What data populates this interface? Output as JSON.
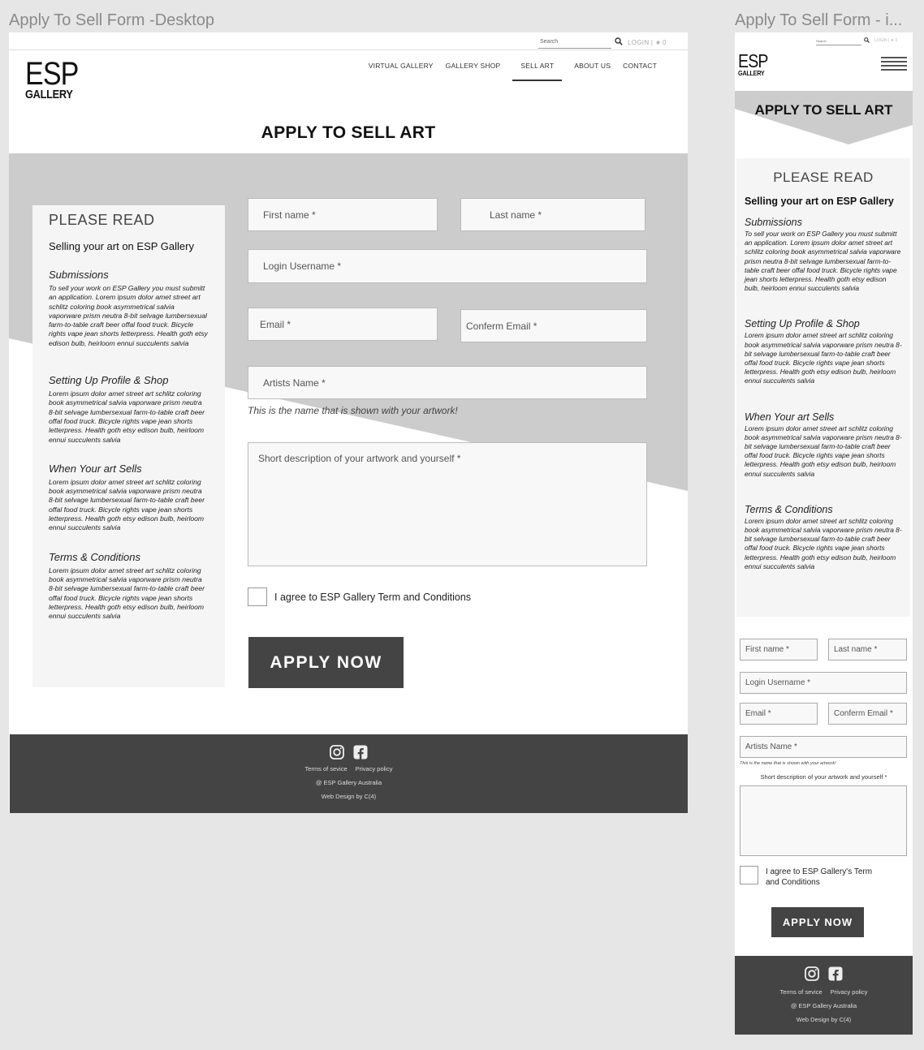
{
  "artboards": {
    "desktop_title": "Apply To Sell Form -Desktop",
    "mobile_title": "Apply To Sell Form - i..."
  },
  "header": {
    "search_placeholder": "Search",
    "login": "LOGIN",
    "cart_count": "0",
    "logo_main": "ESP",
    "logo_sub": "GALLERY",
    "nav": [
      "VIRTUAL GALLERY",
      "GALLERY SHOP",
      "SELL ART",
      "ABOUT US",
      "CONTACT"
    ],
    "active_nav": "SELL ART"
  },
  "page": {
    "title": "APPLY TO SELL ART"
  },
  "info": {
    "heading": "PLEASE READ",
    "subheading": "Selling your art on ESP Gallery",
    "sections": [
      {
        "title": "Submissions",
        "body": "To sell your work on ESP Gallery you must submitt an application.  Lorem ipsum dolor amet street art schlitz coloring book asymmetrical salvia vaporware prism neutra 8-bit selvage lumbersexual farm-to-table craft beer offal food truck. Bicycle rights vape jean shorts letterpress. Health goth etsy edison bulb, heirloom ennui succulents salvia"
      },
      {
        "title": "Setting Up Profile & Shop",
        "body": " Lorem ipsum dolor amet street art schlitz coloring book asymmetrical salvia vaporware prism neutra 8-bit selvage lumbersexual farm-to-table craft beer offal food truck. Bicycle rights vape jean shorts letterpress. Health goth etsy edison bulb, heirloom ennui succulents salvia"
      },
      {
        "title": "When Your art Sells",
        "body": " Lorem ipsum dolor amet street art schlitz coloring book asymmetrical salvia vaporware prism neutra 8-bit selvage lumbersexual farm-to-table craft beer offal food truck. Bicycle rights vape jean shorts letterpress. Health goth etsy edison bulb, heirloom ennui succulents salvia"
      },
      {
        "title": "Terms & Conditions",
        "body": " Lorem ipsum dolor amet street art schlitz coloring book asymmetrical salvia vaporware prism neutra 8-bit selvage lumbersexual farm-to-table craft beer offal food truck. Bicycle rights vape jean shorts letterpress. Health goth etsy edison bulb, heirloom ennui succulents salvia"
      }
    ]
  },
  "form": {
    "first_name": "First name *",
    "last_name": "Last  name *",
    "last_name_mobile": "Last name *",
    "username": "Login Username *",
    "email": "Email *",
    "confirm_email": "Conferm Email *",
    "artist_name": "Artists Name *",
    "artist_hint": "This is the name that is shown with your artwork!",
    "description": "Short description of your artwork and yourself *",
    "agree": "I agree to ESP Gallery Term and Conditions",
    "agree_mobile": "I agree to ESP Gallery's Term and Conditions",
    "submit": "APPLY NOW"
  },
  "footer": {
    "terms": "Terms of sevice",
    "privacy": "Privacy policy",
    "copyright": "@ ESP Gallery Australia",
    "credit": "Web Design by C(4)"
  },
  "icons": {
    "search": "search-icon",
    "instagram": "instagram-icon",
    "facebook": "facebook-icon",
    "menu": "hamburger-menu-icon"
  },
  "colors": {
    "footer_bg": "#444444",
    "button_bg": "#444444",
    "panel_gray": "#cccccc",
    "background": "#e6e6e6"
  }
}
